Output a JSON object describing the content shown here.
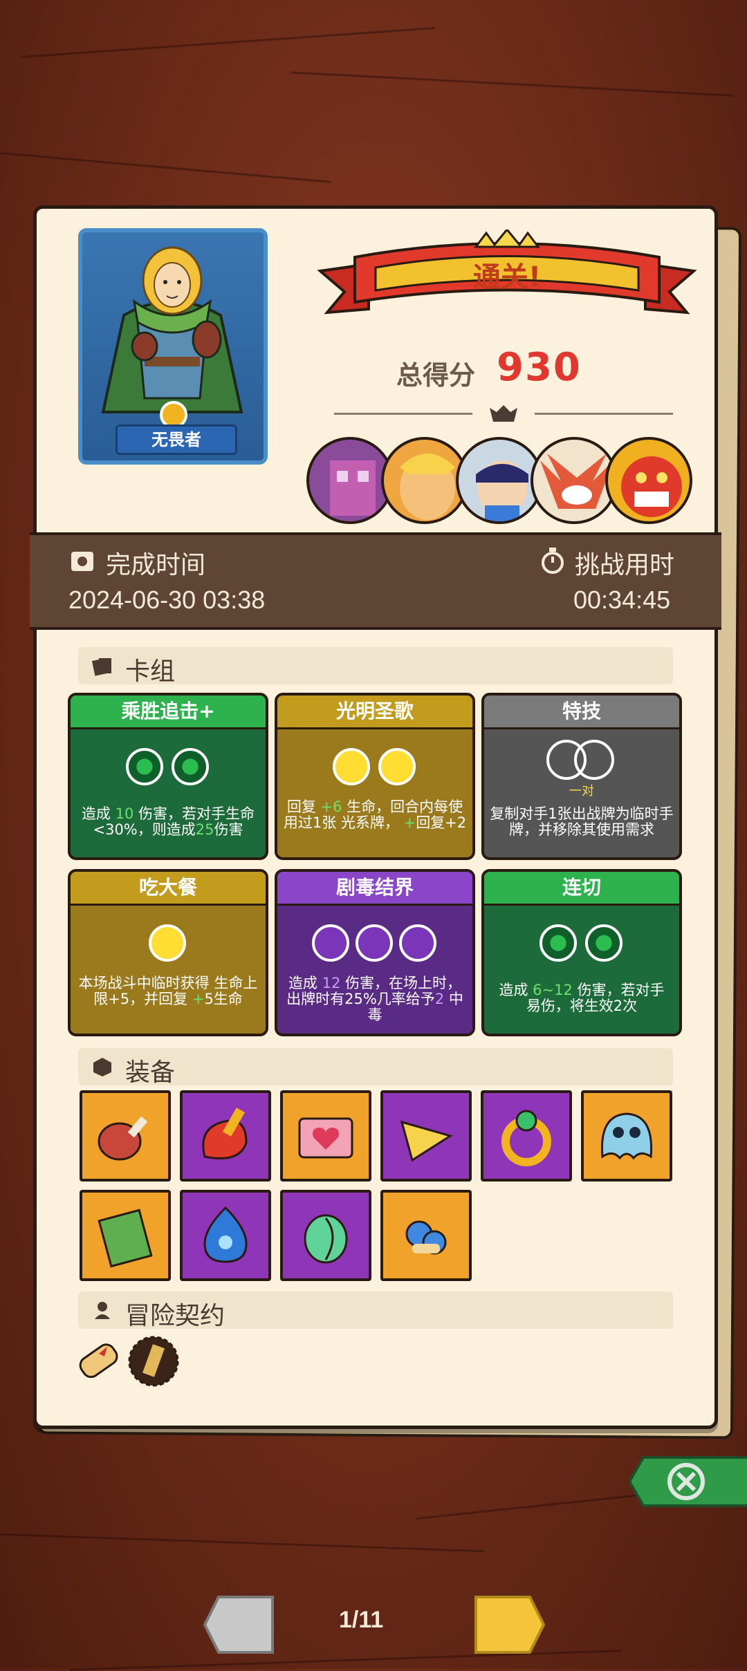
{
  "banner": {
    "title": "通关!"
  },
  "score": {
    "label": "总得分",
    "value": "930"
  },
  "hero": {
    "name": "无畏者"
  },
  "time": {
    "complete_label": "完成时间",
    "complete_value": "2024-06-30 03:38",
    "challenge_label": "挑战用时",
    "challenge_value": "00:34:45"
  },
  "sections": {
    "deck": "卡组",
    "equipment": "装备",
    "contracts": "冒险契约"
  },
  "cards": [
    {
      "title": "乘胜追击+",
      "color": "green",
      "desc_a": "造成 ",
      "num_a": "10",
      "desc_b": " 伤害，若对手生命<30%，则造成",
      "num_b": "25",
      "desc_c": "伤害"
    },
    {
      "title": "光明圣歌",
      "color": "yellow",
      "desc_a": "回复 ",
      "num_a": "+6",
      "desc_b": " 生命，回合内每使用过1张 ",
      "desc_c": "光系牌，",
      "num_b": "+",
      "desc_d": "回复+2"
    },
    {
      "title": "特技",
      "color": "gray",
      "orb_label": "一对",
      "desc": "复制对手1张出战牌为临时手牌，并移除其使用需求"
    },
    {
      "title": "吃大餐",
      "color": "yellow",
      "desc_a": "本场战斗中临时获得 ",
      "desc_b": "生命上限+5，并回复 ",
      "num_a": "+",
      "desc_c": "5生命"
    },
    {
      "title": "剧毒结界",
      "color": "purple",
      "desc_a": "造成 ",
      "num_a": "12",
      "desc_b": " 伤害，在场上时，出牌时有25%几率给予",
      "num_b": "2",
      "desc_c": " 中毒"
    },
    {
      "title": "连切",
      "color": "green",
      "desc_a": "造成 ",
      "num_a": "6~12",
      "desc_b": " 伤害，若对手 ",
      "desc_c": "易伤，将生效2次"
    }
  ],
  "equipment": [
    {
      "name": "meat-icon",
      "color": "orange"
    },
    {
      "name": "fire-fist-icon",
      "color": "purple"
    },
    {
      "name": "heart-box-icon",
      "color": "orange"
    },
    {
      "name": "cheese-icon",
      "color": "purple"
    },
    {
      "name": "gem-ring-icon",
      "color": "purple"
    },
    {
      "name": "slime-icon",
      "color": "orange"
    },
    {
      "name": "moss-brick-icon",
      "color": "orange"
    },
    {
      "name": "blue-flame-icon",
      "color": "purple"
    },
    {
      "name": "leaf-egg-icon",
      "color": "purple"
    },
    {
      "name": "mushroom-icon",
      "color": "orange"
    }
  ],
  "pager": {
    "current": "1/11"
  },
  "colors": {
    "accent_red": "#e0382e",
    "panel": "#fbf1dc",
    "band": "#5e4534"
  }
}
